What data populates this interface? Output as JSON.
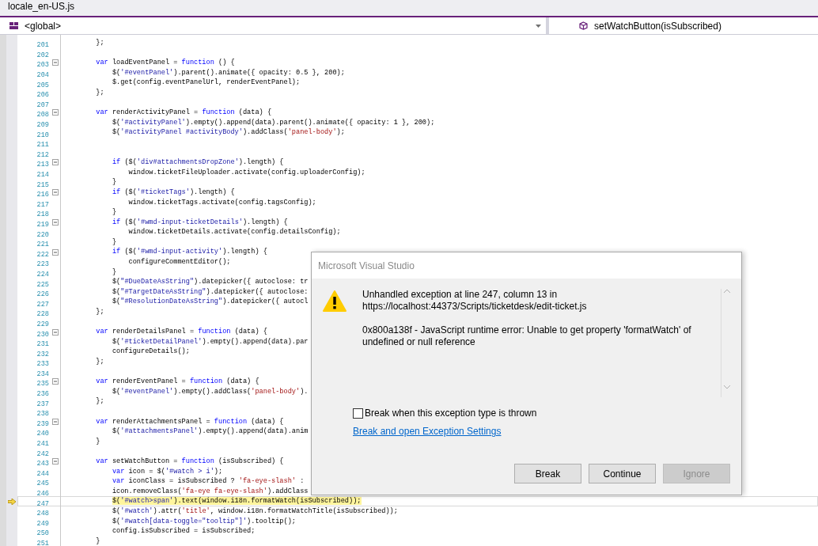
{
  "tab": {
    "title": "locale_en-US.js"
  },
  "navigation": {
    "scope": "<global>",
    "member": "setWatchButton(isSubscribed)"
  },
  "editor": {
    "lines": [
      {
        "number": "201",
        "text": "        };",
        "fold": false,
        "current": false
      },
      {
        "number": "202",
        "fold": false,
        "current": false
      },
      {
        "number": "203",
        "text": "        var loadEventPanel = function () {",
        "fold": true,
        "current": false
      },
      {
        "number": "204",
        "text": "            $('#eventPanel').parent().animate({ opacity: 0.5 }, 200);",
        "fold": false,
        "current": false
      },
      {
        "number": "205",
        "text": "            $.get(config.eventPanelUrl, renderEventPanel);",
        "fold": false,
        "current": false
      },
      {
        "number": "206",
        "text": "        };",
        "fold": false,
        "current": false
      },
      {
        "number": "207",
        "fold": false,
        "current": false
      },
      {
        "number": "208",
        "text": "        var renderActivityPanel = function (data) {",
        "fold": true,
        "current": false
      },
      {
        "number": "209",
        "text": "            $('#activityPanel').empty().append(data).parent().animate({ opacity: 1 }, 200);",
        "fold": false,
        "current": false
      },
      {
        "number": "210",
        "text": "            $('#activityPanel #activityBody').addClass('panel-body');",
        "fold": false,
        "current": false
      },
      {
        "number": "211",
        "fold": false,
        "current": false
      },
      {
        "number": "212",
        "fold": false,
        "current": false
      },
      {
        "number": "213",
        "text": "            if ($('div#attachmentsDropZone').length) {",
        "fold": true,
        "current": false
      },
      {
        "number": "214",
        "text": "                window.ticketFileUploader.activate(config.uploaderConfig);",
        "fold": false,
        "current": false
      },
      {
        "number": "215",
        "text": "            }",
        "fold": false,
        "current": false
      },
      {
        "number": "216",
        "text": "            if ($('#ticketTags').length) {",
        "fold": true,
        "current": false
      },
      {
        "number": "217",
        "text": "                window.ticketTags.activate(config.tagsConfig);",
        "fold": false,
        "current": false
      },
      {
        "number": "218",
        "text": "            }",
        "fold": false,
        "current": false
      },
      {
        "number": "219",
        "text": "            if ($('#wmd-input-ticketDetails').length) {",
        "fold": true,
        "current": false
      },
      {
        "number": "220",
        "text": "                window.ticketDetails.activate(config.detailsConfig);",
        "fold": false,
        "current": false
      },
      {
        "number": "221",
        "text": "            }",
        "fold": false,
        "current": false
      },
      {
        "number": "222",
        "text": "            if ($('#wmd-input-activity').length) {",
        "fold": true,
        "current": false
      },
      {
        "number": "223",
        "text": "                configureCommentEditor();",
        "fold": false,
        "current": false
      },
      {
        "number": "224",
        "text": "            }",
        "fold": false,
        "current": false
      },
      {
        "number": "225",
        "text": "            $(\"#DueDateAsString\").datepicker({ autoclose: tr",
        "fold": false,
        "current": false
      },
      {
        "number": "226",
        "text": "            $(\"#TargetDateAsString\").datepicker({ autoclose:",
        "fold": false,
        "current": false
      },
      {
        "number": "227",
        "text": "            $(\"#ResolutionDateAsString\").datepicker({ autocl",
        "fold": false,
        "current": false
      },
      {
        "number": "228",
        "text": "        };",
        "fold": false,
        "current": false
      },
      {
        "number": "229",
        "fold": false,
        "current": false
      },
      {
        "number": "230",
        "text": "        var renderDetailsPanel = function (data) {",
        "fold": true,
        "current": false
      },
      {
        "number": "231",
        "text": "            $('#ticketDetailPanel').empty().append(data).par",
        "fold": false,
        "current": false
      },
      {
        "number": "232",
        "text": "            configureDetails();",
        "fold": false,
        "current": false
      },
      {
        "number": "233",
        "text": "        };",
        "fold": false,
        "current": false
      },
      {
        "number": "234",
        "fold": false,
        "current": false
      },
      {
        "number": "235",
        "text": "        var renderEventPanel = function (data) {",
        "fold": true,
        "current": false
      },
      {
        "number": "236",
        "text": "            $('#eventPanel').empty().addClass('panel-body').",
        "fold": false,
        "current": false
      },
      {
        "number": "237",
        "text": "        };",
        "fold": false,
        "current": false
      },
      {
        "number": "238",
        "fold": false,
        "current": false
      },
      {
        "number": "239",
        "text": "        var renderAttachmentsPanel = function (data) {",
        "fold": true,
        "current": false
      },
      {
        "number": "240",
        "text": "            $('#attachmentsPanel').empty().append(data).anim",
        "fold": false,
        "current": false
      },
      {
        "number": "241",
        "text": "        }",
        "fold": false,
        "current": false
      },
      {
        "number": "242",
        "fold": false,
        "current": false
      },
      {
        "number": "243",
        "text": "        var setWatchButton = function (isSubscribed) {",
        "fold": true,
        "current": false
      },
      {
        "number": "244",
        "text": "            var icon = $('#watch > i');",
        "fold": false,
        "current": false
      },
      {
        "number": "245",
        "text": "            var iconClass = isSubscribed ? 'fa-eye-slash' :",
        "fold": false,
        "current": false
      },
      {
        "number": "246",
        "text": "            icon.removeClass('fa-eye fa-eye-slash').addClass",
        "fold": false,
        "current": false
      },
      {
        "number": "247",
        "text": "            $('#watch>span').text(window.i18n.formatWatch(isSubscribed));",
        "fold": false,
        "current": true
      },
      {
        "number": "248",
        "text": "            $('#watch').attr('title', window.i18n.formatWatchTitle(isSubscribed));",
        "fold": false,
        "current": false
      },
      {
        "number": "249",
        "text": "            $('#watch[data-toggle=\"tooltip\"]').tooltip();",
        "fold": false,
        "current": false
      },
      {
        "number": "250",
        "text": "            config.isSubscribed = isSubscribed;",
        "fold": false,
        "current": false
      },
      {
        "number": "251",
        "text": "        }",
        "fold": false,
        "current": false
      }
    ]
  },
  "dialog": {
    "title": "Microsoft Visual Studio",
    "messages": [
      "Unhandled exception at line 247, column 13 in",
      "https://localhost:44373/Scripts/ticketdesk/edit-ticket.js",
      "0x800a138f - JavaScript runtime error: Unable to get property 'formatWatch' of undefined or null reference"
    ],
    "checkbox": {
      "label": "Break when this exception type is thrown",
      "checked": false
    },
    "link": "Break and open Exception Settings",
    "buttons": [
      {
        "label": "Break",
        "disabled": false
      },
      {
        "label": "Continue",
        "disabled": false
      },
      {
        "label": "Ignore",
        "disabled": true
      }
    ]
  }
}
